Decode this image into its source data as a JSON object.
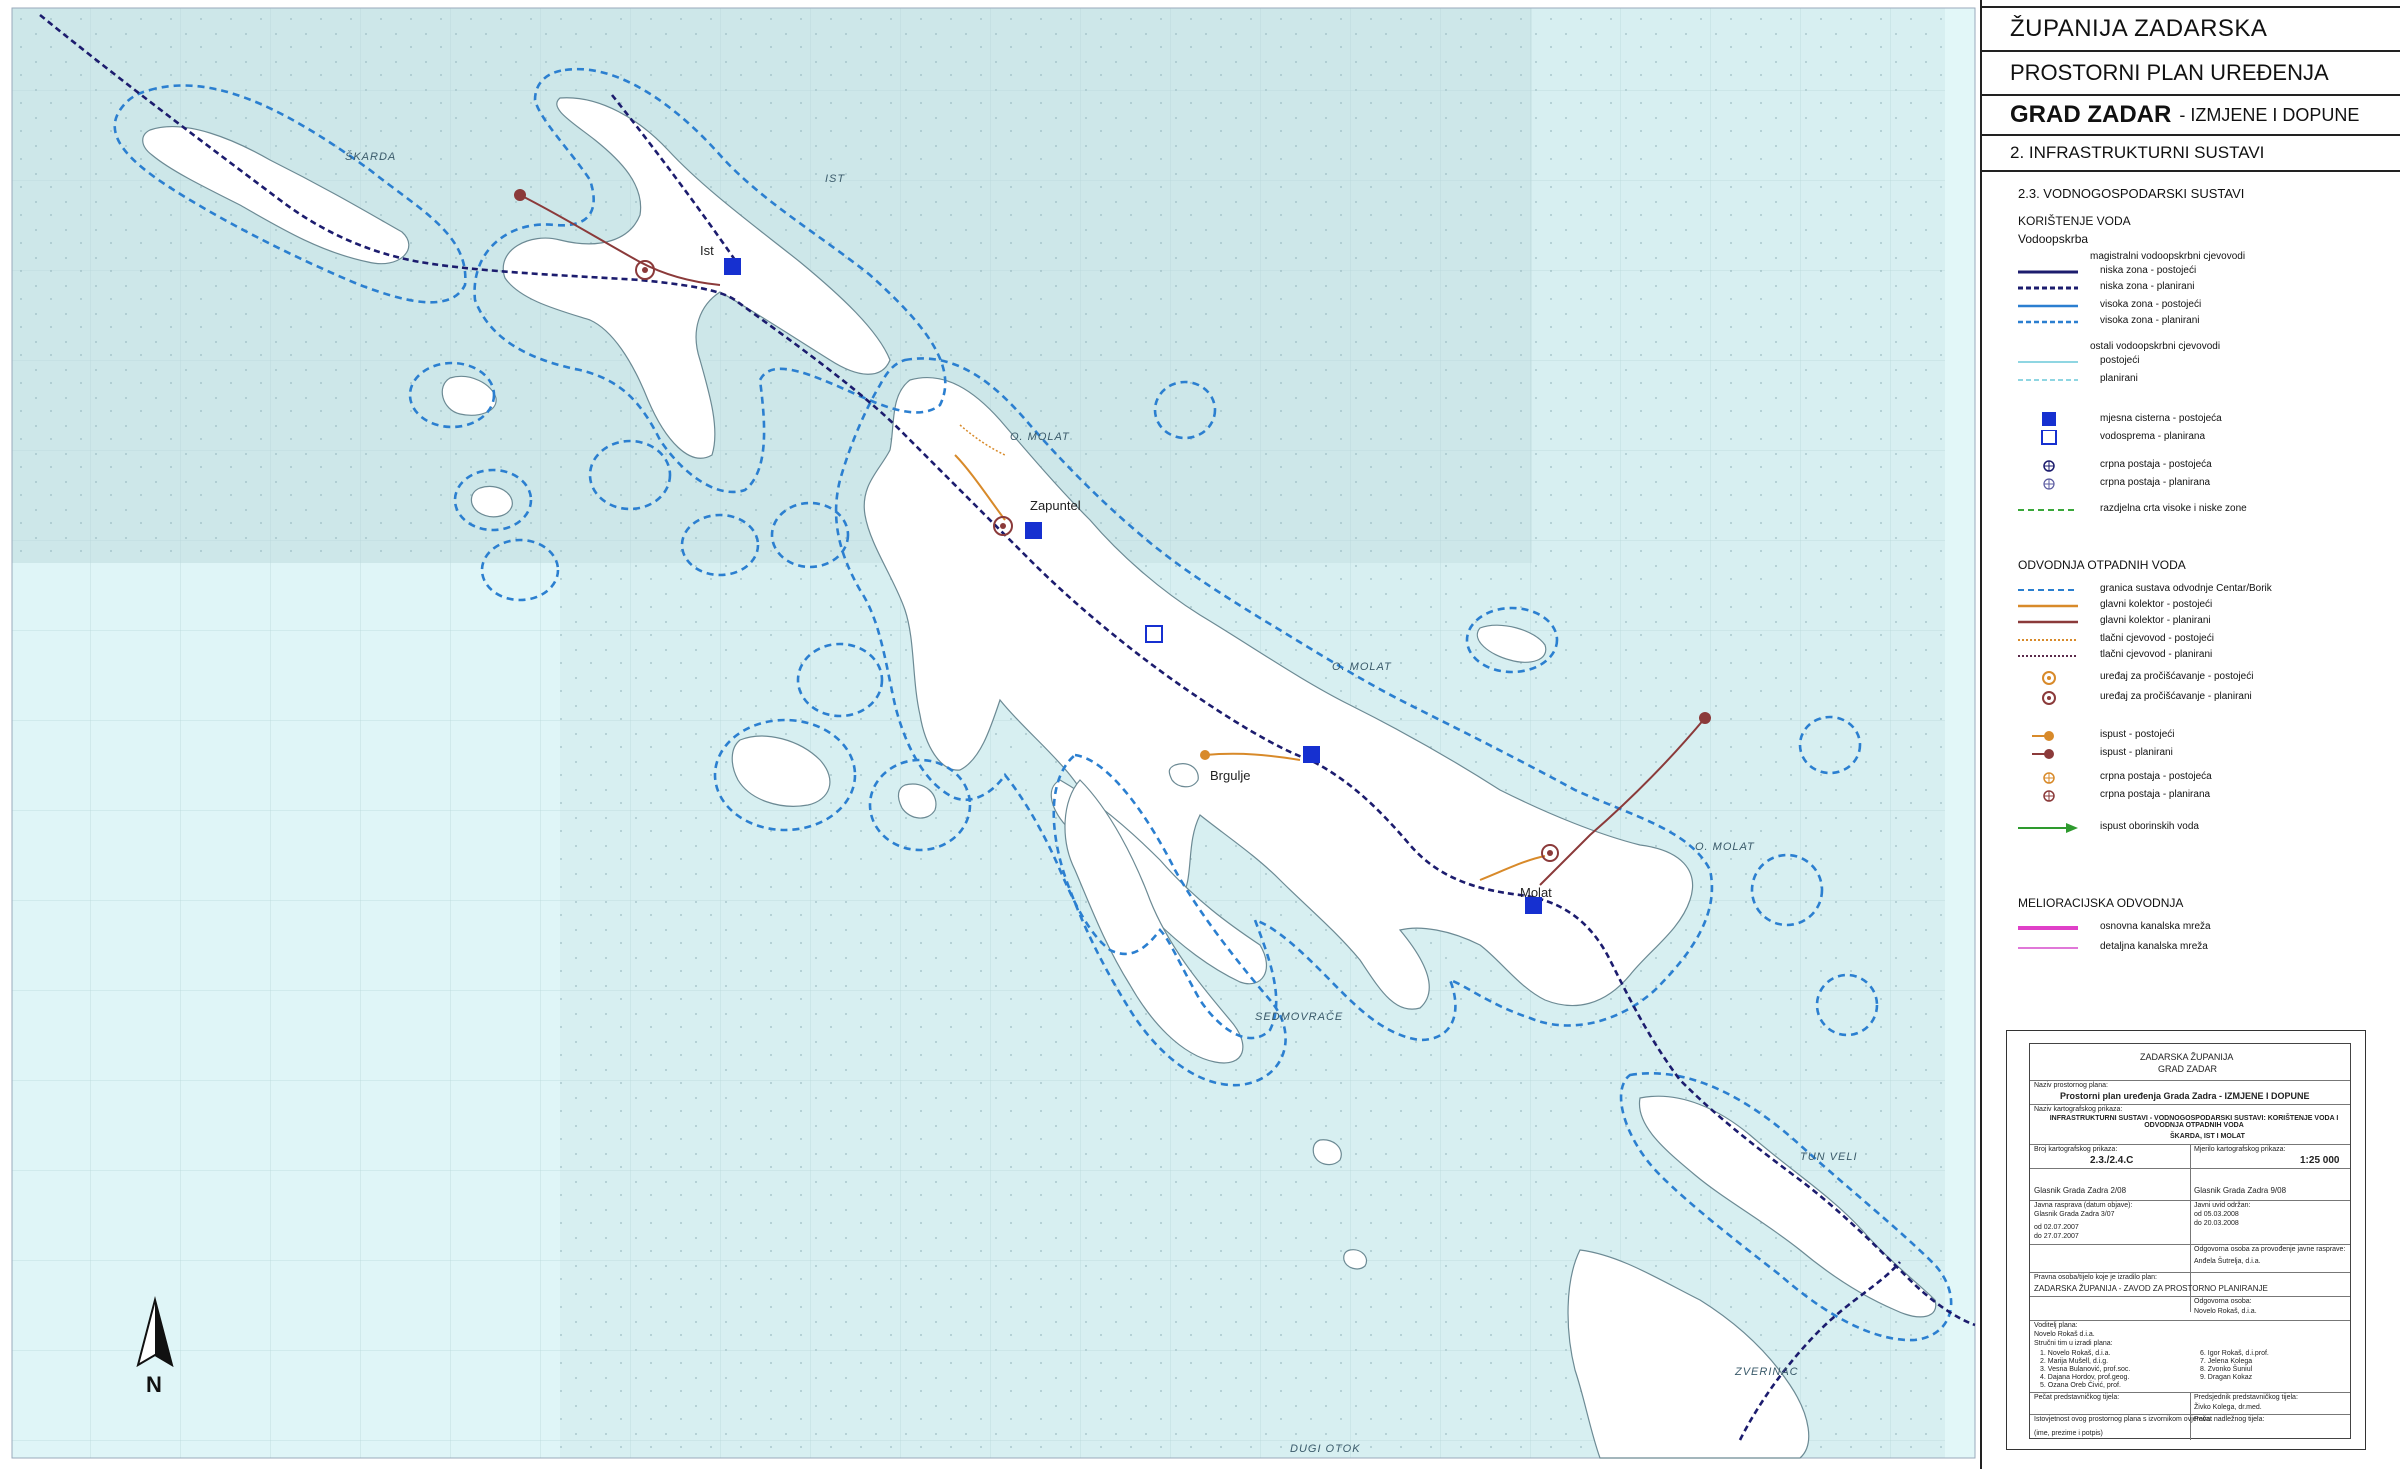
{
  "map": {
    "north_label": "N",
    "place_labels": [
      "ŠKARDA",
      "IST",
      "O. MOLAT",
      "O. MOLAT",
      "O. MOLAT",
      "SEDMOVRAČE",
      "DUGI OTOK",
      "ZVERINAC",
      "TUN VELI"
    ],
    "town_labels": [
      "Molat",
      "Zapuntel",
      "Ist",
      "Brgulje"
    ],
    "colors": {
      "sea": "#d6eef0",
      "sea_darker": "#cde6e8",
      "land": "#ffffff",
      "land_edge": "#6c8a94",
      "buffer": "#2b7fd0",
      "main_pipe": "#1c1c6e",
      "collector": "#8b3a3a",
      "orange": "#d88a2a",
      "tank": "#1630d0"
    }
  },
  "header": {
    "county": "ŽUPANIJA ZADARSKA",
    "plan": "PROSTORNI PLAN UREĐENJA",
    "city": "GRAD ZADAR",
    "city_suffix": "- IZMJENE I DOPUNE",
    "section": "2. INFRASTRUKTURNI SUSTAVI"
  },
  "legend": {
    "subsection": "2.3. VODNOGOSPODARSKI SUSTAVI",
    "water_use_title": "KORIŠTENJE VODA",
    "water_supply_title": "Vodoopskrba",
    "supply_items": [
      {
        "text": "magistralni vodoopskrbni cjevovodi",
        "symbol": "none"
      },
      {
        "text": "niska zona - postojeći",
        "symbol": "line-solid-navy"
      },
      {
        "text": "niska zona - planirani",
        "symbol": "line-dash-navy"
      },
      {
        "text": "visoka zona - postojeći",
        "symbol": "line-solid-blue"
      },
      {
        "text": "visoka zona - planirani",
        "symbol": "line-dash-blue"
      },
      {
        "text": "ostali vodoopskrbni cjevovodi",
        "symbol": "none"
      },
      {
        "text": "postojeći",
        "symbol": "line-solid-light"
      },
      {
        "text": "planirani",
        "symbol": "line-dash-light"
      },
      {
        "text": "mjesna cisterna - postojeća",
        "symbol": "square-filled"
      },
      {
        "text": "vodosprema - planirana",
        "symbol": "square-open"
      },
      {
        "text": "crpna postaja - postojeća",
        "symbol": "pump-navy"
      },
      {
        "text": "crpna postaja - planirana",
        "symbol": "pump-navy-open"
      },
      {
        "text": "razdjelna crta visoke i niske zone",
        "symbol": "line-dash-green"
      }
    ],
    "waste_title": "ODVODNJA OTPADNIH VODA",
    "waste_items": [
      {
        "text": "granica sustava odvodnje Centar/Borik",
        "symbol": "line-dash-cyan"
      },
      {
        "text": "glavni kolektor - postojeći",
        "symbol": "line-solid-orange"
      },
      {
        "text": "glavni kolektor - planirani",
        "symbol": "line-solid-brown"
      },
      {
        "text": "tlačni cjevovod - postojeći",
        "symbol": "line-dot-orange"
      },
      {
        "text": "tlačni cjevovod - planirani",
        "symbol": "line-dot-brown"
      },
      {
        "text": "uređaj za pročišćavanje - postojeći",
        "symbol": "plant-orange"
      },
      {
        "text": "uređaj za pročišćavanje - planirani",
        "symbol": "plant-brown"
      },
      {
        "text": "ispust - postojeći",
        "symbol": "outfall-orange"
      },
      {
        "text": "ispust - planirani",
        "symbol": "outfall-brown"
      },
      {
        "text": "crpna postaja - postojeća",
        "symbol": "pump-orange"
      },
      {
        "text": "crpna postaja - planirana",
        "symbol": "pump-brown"
      },
      {
        "text": "ispust oborinskih voda",
        "symbol": "arrow-green"
      }
    ],
    "melior_title": "MELIORACIJSKA ODVODNJA",
    "melior_items": [
      {
        "text": "osnovna kanalska mreža",
        "symbol": "line-magenta-thick"
      },
      {
        "text": "detaljna kanalska mreža",
        "symbol": "line-magenta-thin"
      }
    ]
  },
  "title_block": {
    "org": "ZADARSKA ŽUPANIJA",
    "city": "GRAD ZADAR",
    "plan_name_label": "Naziv prostornog plana:",
    "plan_name": "Prostorni plan uređenja Grada Zadra - IZMJENE I DOPUNE",
    "map_name_label": "Naziv kartografskog prikaza:",
    "map_name": "INFRASTRUKTURNI SUSTAVI - VODNOGOSPODARSKI SUSTAVI: KORIŠTENJE VODA I ODVODNJA OTPADNIH VODA",
    "map_sub": "ŠKARDA, IST I MOLAT",
    "map_no_label": "Broj kartografskog prikaza:",
    "map_no": "2.3./2.4.C",
    "scale_label": "Mjerilo kartografskog prikaza:",
    "scale": "1:25 000",
    "gazette": "Glasnik Grada Zadra 2/08",
    "gazette2": "Glasnik Grada Zadra 9/08",
    "public_debate": "Javna rasprava (datum objave):",
    "public_dates": "Glasnik Grada Zadra 3/07",
    "enacted": "Javni uvid održan:",
    "date_a": "od 02.07.2007",
    "date_b": "do 27.07.2007",
    "date_c": "od 05.03.2008",
    "date_d": "do 20.03.2008",
    "official": "Odgovorna osoba za provođenje javne rasprave:",
    "official_name": "Anđela Šutrelja, d.i.a.",
    "plan_maker_label": "Pravna osoba/tijelo koje je izradilo plan:",
    "plan_maker": "ZADARSKA ŽUPANIJA - ZAVOD ZA PROSTORNO PLANIRANJE",
    "head_label": "Odgovorna osoba:",
    "head_name": "Novelo Rokaš, d.i.a.",
    "coord_label": "Voditelj plana:",
    "coord_name": "Novelo Rokaš d.i.a.",
    "team_label": "Stručni tim u izradi plana:",
    "team_left": [
      "1. Novelo Rokaš, d.i.a.",
      "2. Marija Mušell, d.i.g.",
      "3. Vesna Bulanović, prof.soc.",
      "4. Dajana Hordov, prof.geog.",
      "5. Ozana Oreb Čivić, prof."
    ],
    "team_right": [
      "6. Igor Rokaš, d.i.prof.",
      "7. Jelena Kolega",
      "8. Zvonko Šuniul",
      "9. Dragan Kokaz"
    ],
    "seal_label": "Pečat predstavničkog tijela:",
    "president_label": "Predsjednik predstavničkog tijela:",
    "president_name": "Živko Kolega, dr.med.",
    "reg_label": "Istovjetnost ovog prostornog plana s izvornikom ovjerava:",
    "reg_seal": "Pečat nadležnog tijela:",
    "sign_name": "(ime, prezime i potpis)"
  }
}
